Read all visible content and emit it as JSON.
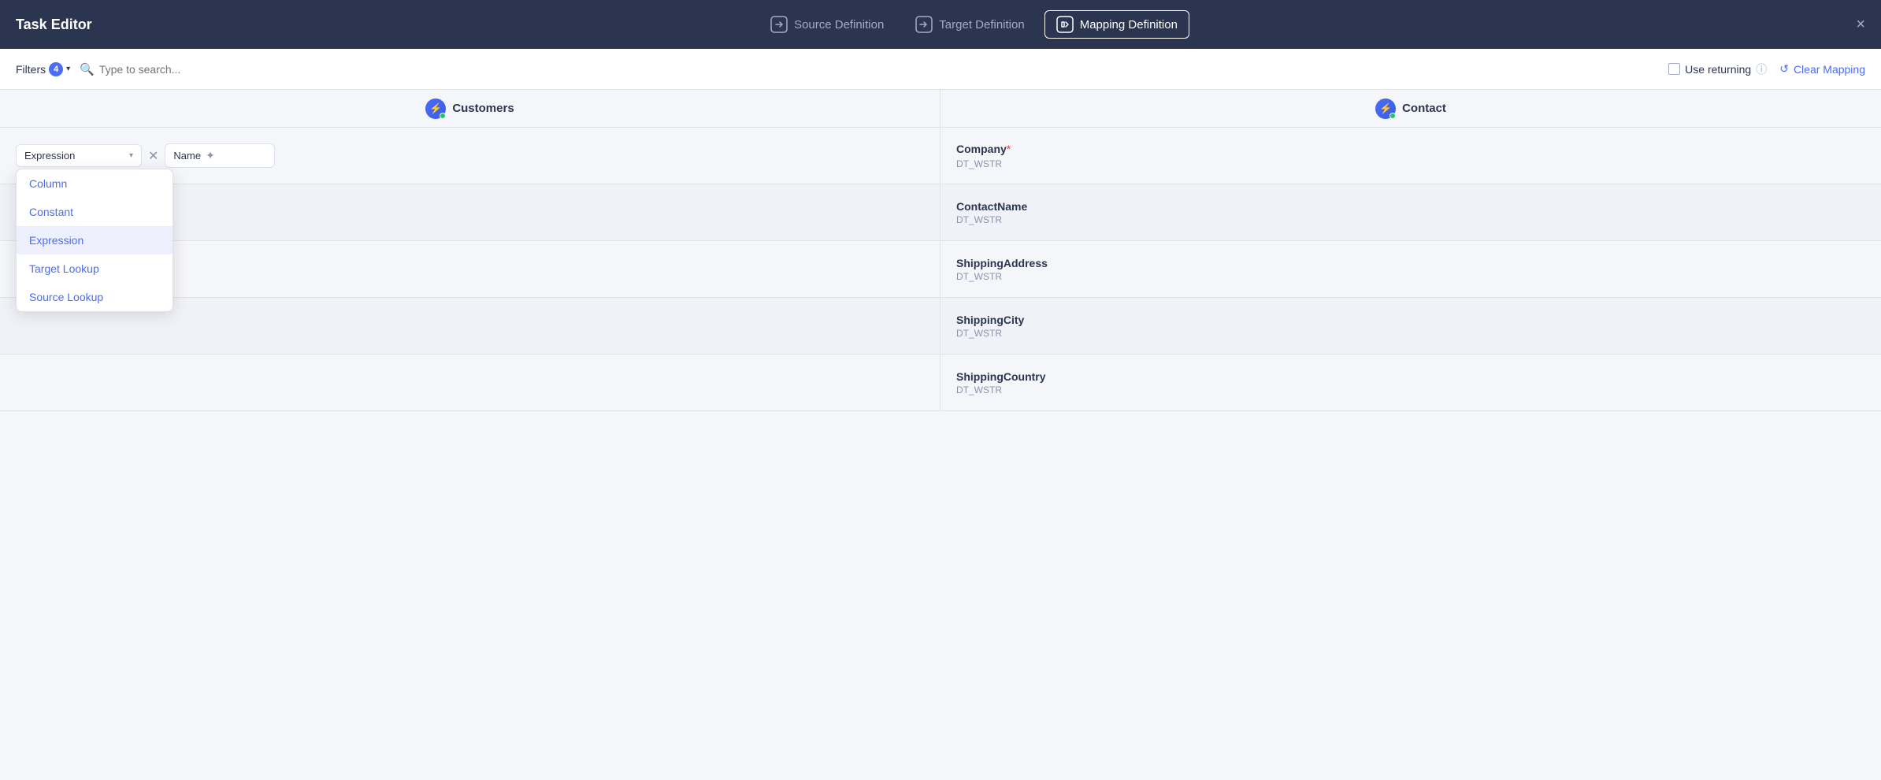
{
  "header": {
    "title": "Task Editor",
    "close_label": "×",
    "tabs": [
      {
        "id": "source",
        "label": "Source Definition",
        "icon": "→|",
        "active": false
      },
      {
        "id": "target",
        "label": "Target Definition",
        "icon": "→|",
        "active": false
      },
      {
        "id": "mapping",
        "label": "Mapping Definition",
        "icon": "♫",
        "active": true
      }
    ]
  },
  "toolbar": {
    "filters_label": "Filters",
    "filters_count": "4",
    "search_placeholder": "Type to search...",
    "use_returning_label": "Use returning",
    "clear_mapping_label": "Clear Mapping"
  },
  "columns": {
    "source": {
      "name": "Customers"
    },
    "target": {
      "name": "Contact"
    }
  },
  "expression_dropdown": {
    "selected": "Expression",
    "options": [
      "Column",
      "Constant",
      "Expression",
      "Target Lookup",
      "Source Lookup"
    ]
  },
  "source_name_value": "Name",
  "mapping_rows": [
    {
      "id": "row1",
      "has_mapping": true,
      "target_field": "Company",
      "target_type": "DT_WSTR",
      "required": true,
      "source_expression": "Expression",
      "source_value": "Name"
    },
    {
      "id": "row2",
      "has_mapping": false,
      "target_field": "ContactName",
      "target_type": "DT_WSTR",
      "required": false
    },
    {
      "id": "row3",
      "has_mapping": false,
      "target_field": "ShippingAddress",
      "target_type": "DT_WSTR",
      "required": false
    },
    {
      "id": "row4",
      "has_mapping": false,
      "target_field": "ShippingCity",
      "target_type": "DT_WSTR",
      "required": false
    },
    {
      "id": "row5",
      "has_mapping": false,
      "target_field": "ShippingCountry",
      "target_type": "DT_WSTR",
      "required": false
    }
  ],
  "colors": {
    "accent": "#4a6cf7",
    "required": "#e53e3e",
    "text_primary": "#2c3550",
    "text_secondary": "#8a93a8"
  }
}
